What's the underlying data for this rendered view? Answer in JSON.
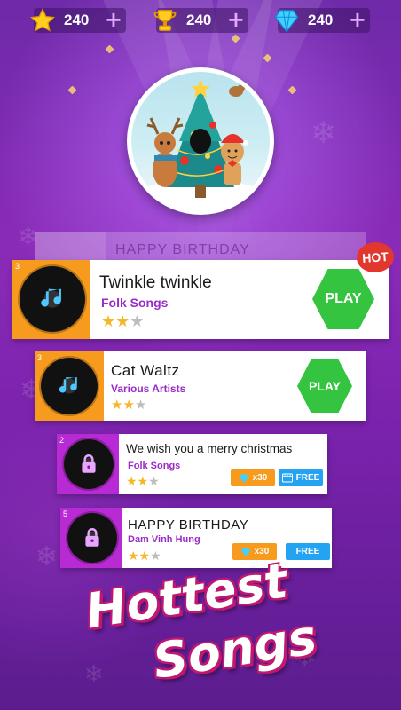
{
  "stats": [
    {
      "icon": "star-icon",
      "value": "240",
      "plus": "+"
    },
    {
      "icon": "trophy-icon",
      "value": "240",
      "plus": "+"
    },
    {
      "icon": "diamond-icon",
      "value": "240",
      "plus": "+"
    }
  ],
  "ghost_song": {
    "title": "HAPPY BIRTHDAY"
  },
  "hot_badge": "HOT",
  "songs": [
    {
      "rank": "3",
      "title": "Twinkle twinkle",
      "artist": "Folk Songs",
      "stars": 2,
      "action": "PLAY",
      "locked": false
    },
    {
      "rank": "3",
      "title": "Cat Waltz",
      "artist": "Various Artists",
      "stars": 2,
      "action": "PLAY",
      "locked": false
    },
    {
      "rank": "2",
      "title": "We wish you a merry christmas",
      "artist": "Folk Songs",
      "stars": 2,
      "diamond_cost": "x30",
      "free_label": "FREE",
      "locked": true
    },
    {
      "rank": "5",
      "title": "HAPPY BIRTHDAY",
      "artist": "Dam Vinh Hung",
      "stars": 2,
      "diamond_cost": "x30",
      "free_label": "FREE",
      "locked": true
    }
  ],
  "headline": {
    "line1": "Hottest",
    "line2": "Songs"
  },
  "colors": {
    "accent_orange": "#f79b1e",
    "accent_pink": "#b72ad4",
    "play_green": "#35c43f",
    "free_blue": "#24a3f2",
    "artist_purple": "#9b2bc8"
  }
}
